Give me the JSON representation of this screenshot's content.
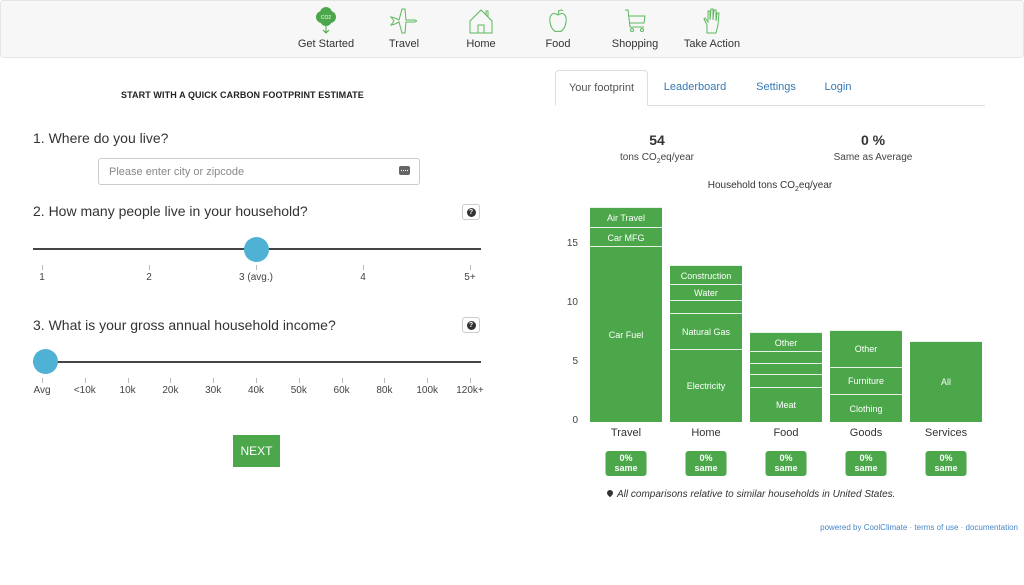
{
  "nav": {
    "items": [
      {
        "label": "Get Started",
        "icon": "co2-cloud-icon",
        "active": true
      },
      {
        "label": "Travel",
        "icon": "airplane-icon"
      },
      {
        "label": "Home",
        "icon": "house-icon"
      },
      {
        "label": "Food",
        "icon": "apple-icon"
      },
      {
        "label": "Shopping",
        "icon": "cart-icon"
      },
      {
        "label": "Take Action",
        "icon": "hand-icon"
      }
    ],
    "accent_color": "#4ba74a"
  },
  "intro": {
    "title": "START WITH A QUICK CARBON FOOTPRINT ESTIMATE",
    "q1": "1. Where do you live?",
    "location_placeholder": "Please enter city or zipcode",
    "location_value": "",
    "q2": "2. How many people live in your household?",
    "household_ticks": [
      "1",
      "2",
      "3 (avg.)",
      "4",
      "5+"
    ],
    "household_selected": "3 (avg.)",
    "q3": "3. What is your gross annual household income?",
    "income_ticks": [
      "Avg",
      "<10k",
      "10k",
      "20k",
      "30k",
      "40k",
      "50k",
      "60k",
      "80k",
      "100k",
      "120k+"
    ],
    "income_selected": "Avg",
    "help_icon": "question-circle-icon",
    "next_label": "NEXT"
  },
  "tabs": [
    {
      "label": "Your footprint",
      "active": true
    },
    {
      "label": "Leaderboard"
    },
    {
      "label": "Settings"
    },
    {
      "label": "Login"
    }
  ],
  "summary": {
    "total_value": "54",
    "total_unit_pre": "tons CO",
    "total_unit_sub": "2",
    "total_unit_post": "eq/year",
    "compare_value": "0 %",
    "compare_label": "Same as Average"
  },
  "chart_data": {
    "type": "bar",
    "stacked": true,
    "title_pre": "Household tons CO",
    "title_sub": "2",
    "title_post": "eq/year",
    "ylim": [
      0,
      18.5
    ],
    "yticks": [
      0,
      5,
      10,
      15
    ],
    "categories": [
      "Travel",
      "Home",
      "Food",
      "Goods",
      "Services"
    ],
    "bars": [
      {
        "category": "Travel",
        "segments": [
          {
            "label": "Car Fuel",
            "value": 14.9
          },
          {
            "label": "Car MFG",
            "value": 1.6
          },
          {
            "label": "Air Travel",
            "value": 1.7
          }
        ]
      },
      {
        "category": "Home",
        "segments": [
          {
            "label": "Electricity",
            "value": 6.2
          },
          {
            "label": "Natural Gas",
            "value": 3.0
          },
          {
            "label": "",
            "value": 1.1
          },
          {
            "label": "Water",
            "value": 1.4
          },
          {
            "label": "Construction",
            "value": 1.6
          }
        ]
      },
      {
        "category": "Food",
        "segments": [
          {
            "label": "Meat",
            "value": 3.0
          },
          {
            "label": "",
            "value": 1.1
          },
          {
            "label": "",
            "value": 0.9
          },
          {
            "label": "",
            "value": 1.0
          },
          {
            "label": "Other",
            "value": 1.6
          }
        ]
      },
      {
        "category": "Goods",
        "segments": [
          {
            "label": "Clothing",
            "value": 2.4
          },
          {
            "label": "Furniture",
            "value": 2.3
          },
          {
            "label": "Other",
            "value": 3.1
          }
        ]
      },
      {
        "category": "Services",
        "segments": [
          {
            "label": "All",
            "value": 6.9
          }
        ]
      }
    ],
    "badges": [
      {
        "line1": "0%",
        "line2": "same"
      },
      {
        "line1": "0%",
        "line2": "same"
      },
      {
        "line1": "0%",
        "line2": "same"
      },
      {
        "line1": "0%",
        "line2": "same"
      },
      {
        "line1": "0%",
        "line2": "same"
      }
    ],
    "bar_color": "#4ba74a"
  },
  "footnote": "All comparisons relative to similar households in United States.",
  "footer": {
    "powered": "powered by CoolClimate",
    "terms": "terms of use",
    "docs": "documentation",
    "sep": " · "
  }
}
